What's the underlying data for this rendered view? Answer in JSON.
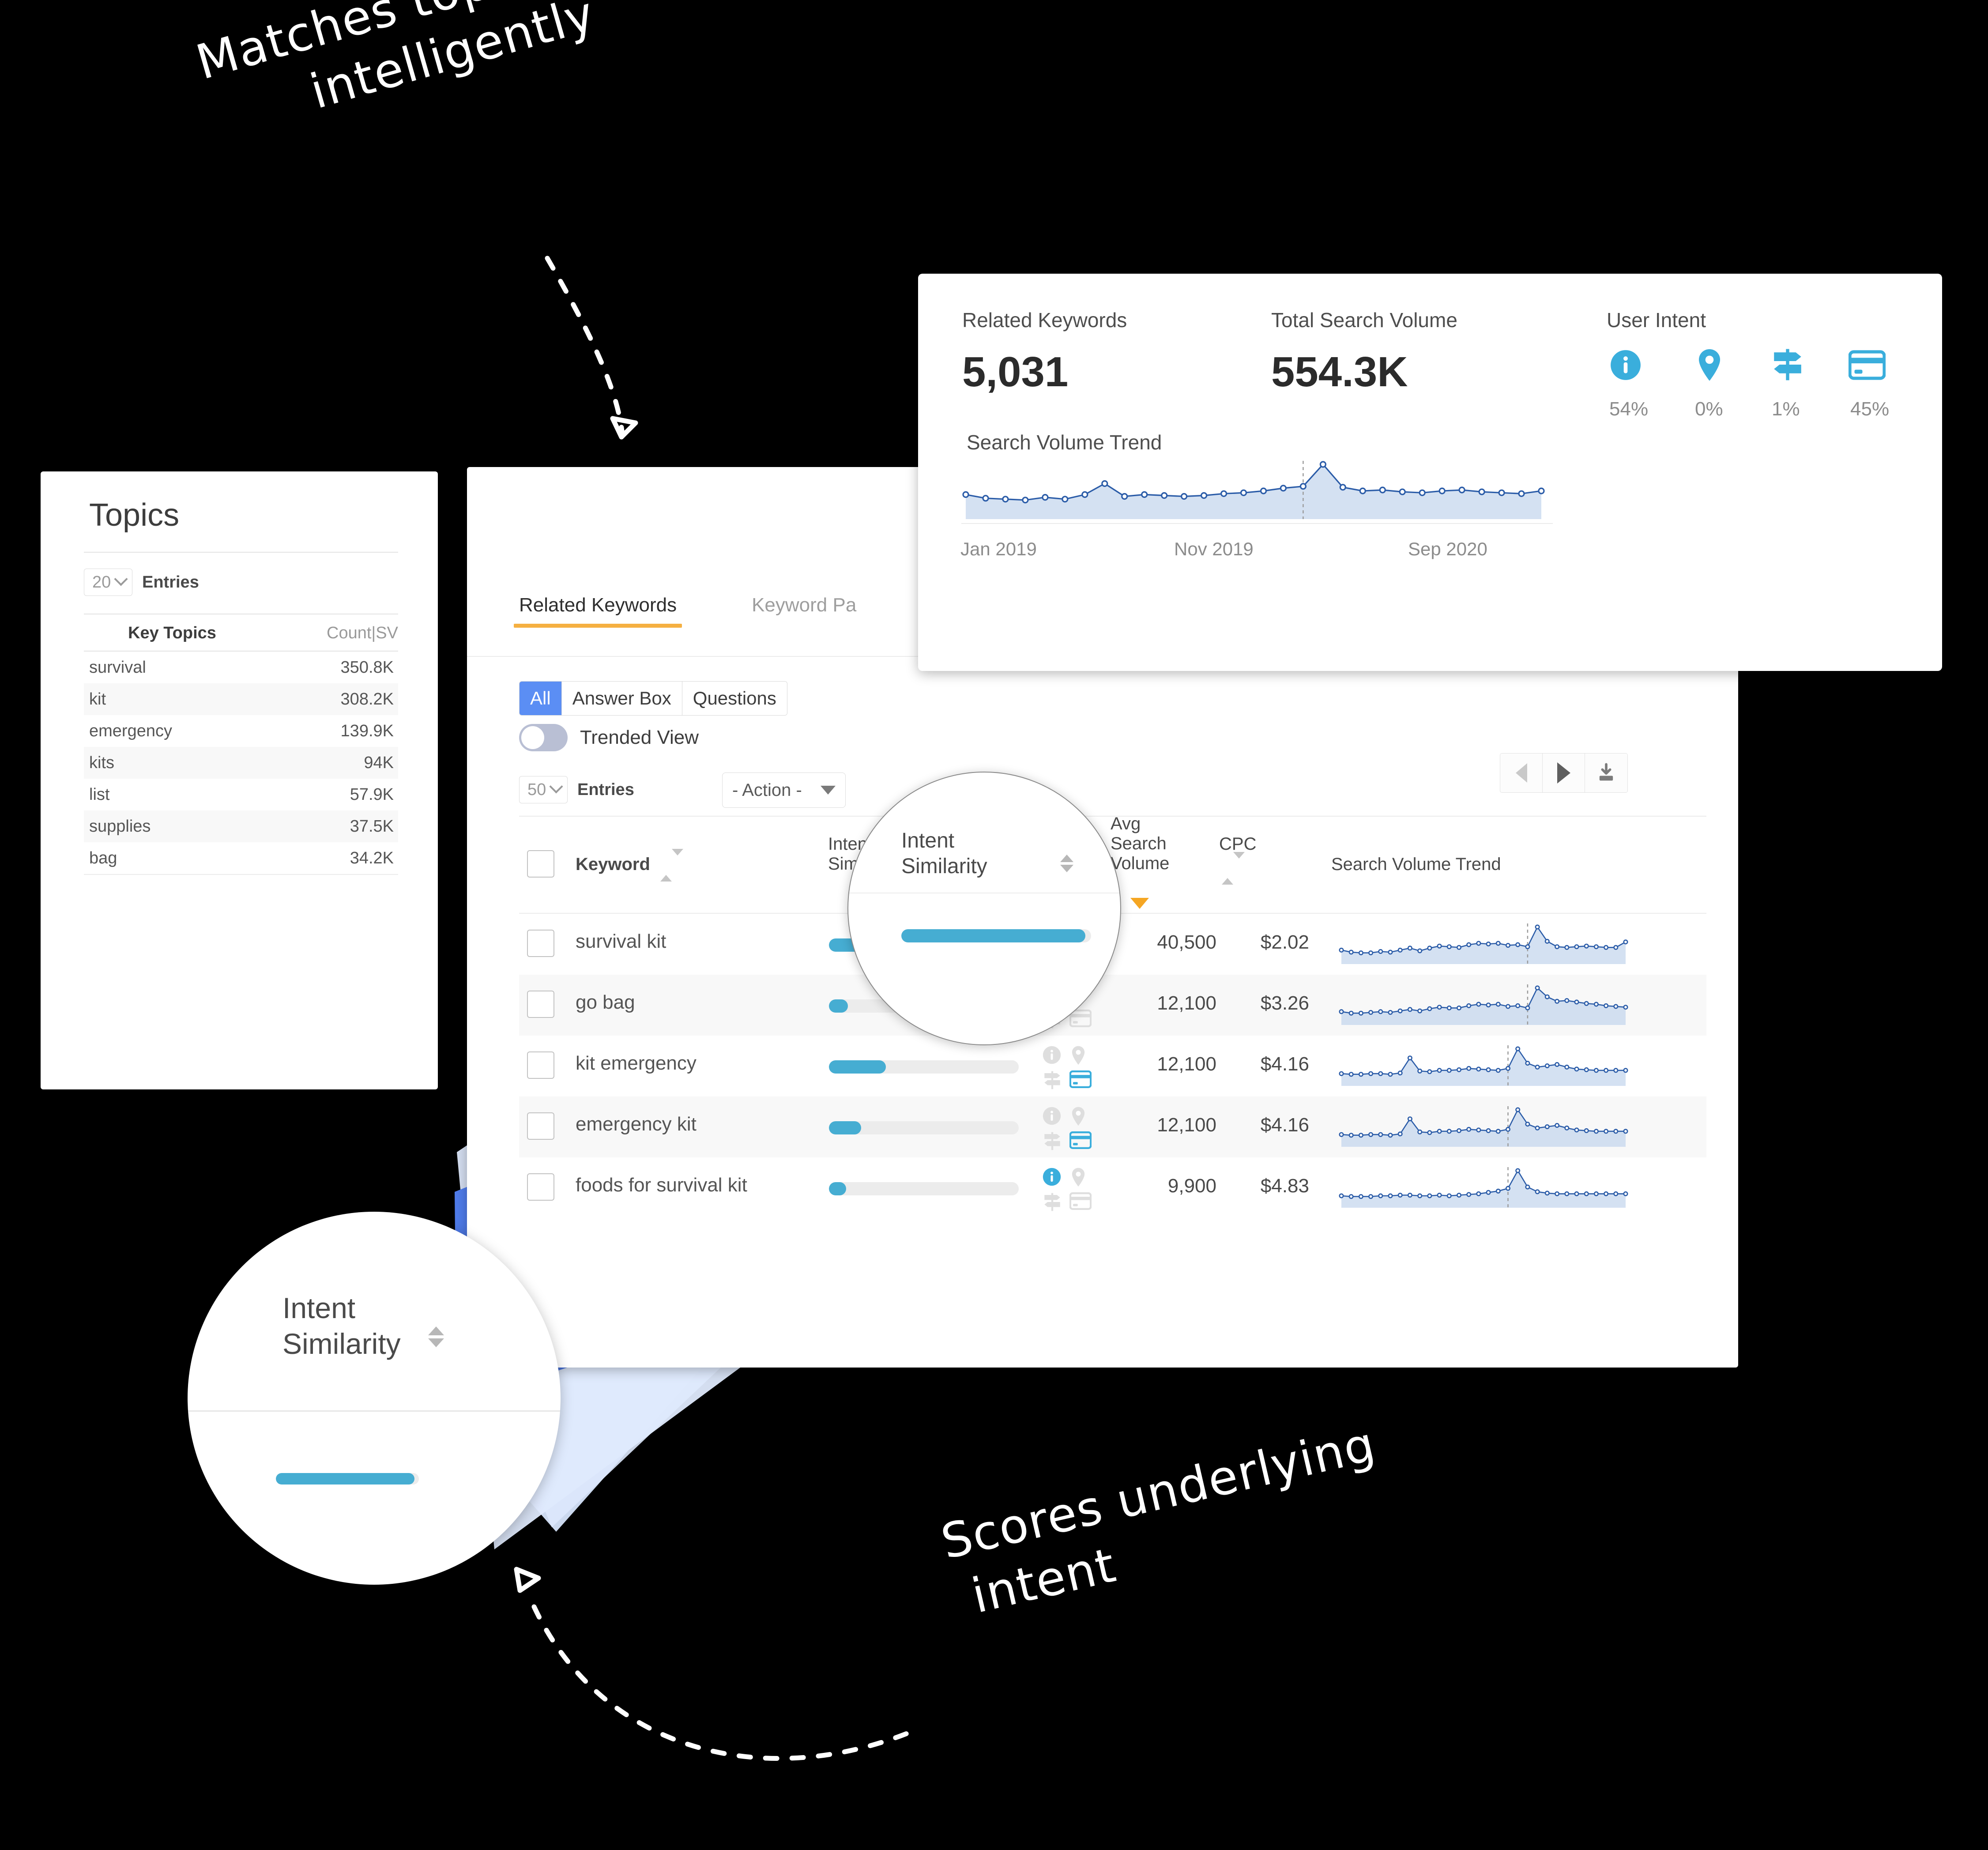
{
  "annotations": {
    "top": {
      "line1": "Matches topics",
      "line2": "intelligently"
    },
    "bottom": {
      "line1": "Scores underlying",
      "line2": "intent"
    }
  },
  "topics_panel": {
    "title": "Topics",
    "entries_value": "20",
    "entries_label": "Entries",
    "columns": {
      "key_topics": "Key Topics",
      "count_sv": "Count|SV"
    },
    "rows": [
      {
        "topic": "survival",
        "value": "350.8K"
      },
      {
        "topic": "kit",
        "value": "308.2K"
      },
      {
        "topic": "emergency",
        "value": "139.9K"
      },
      {
        "topic": "kits",
        "value": "94K"
      },
      {
        "topic": "list",
        "value": "57.9K"
      },
      {
        "topic": "supplies",
        "value": "37.5K"
      },
      {
        "topic": "bag",
        "value": "34.2K"
      }
    ]
  },
  "main_panel": {
    "tabs": [
      {
        "label": "Related Keywords",
        "active": true
      },
      {
        "label": "Keyword Pa",
        "active": false
      }
    ],
    "segmented": [
      {
        "label": "All",
        "active": true
      },
      {
        "label": "Answer Box",
        "active": false
      },
      {
        "label": "Questions",
        "active": false
      }
    ],
    "trended_view_label": "Trended View",
    "trended_view_on": false,
    "entries_value": "50",
    "entries_label": "Entries",
    "action_label": "- Action -",
    "pager": {
      "prev_icon": "chevron-left-icon",
      "next_icon": "chevron-right-icon",
      "download_icon": "download-icon"
    },
    "table": {
      "columns": {
        "keyword": "Keyword",
        "intent_similarity": "Intent\nSimilarity",
        "user_intent": "User\nIntent",
        "avg_search_volume": "Avg\nSearch\nVolume",
        "cpc": "CPC",
        "search_volume_trend": "Search Volume Trend"
      },
      "sorted_by": "avg_search_volume",
      "sort_direction": "desc",
      "rows": [
        {
          "keyword": "survival kit",
          "intent_similarity_pct": 97,
          "intents": [
            "informational"
          ],
          "avg_search_volume": "40,500",
          "cpc": "$2.02"
        },
        {
          "keyword": "go bag",
          "intent_similarity_pct": 10,
          "intents": [
            "informational"
          ],
          "avg_search_volume": "12,100",
          "cpc": "$3.26"
        },
        {
          "keyword": "kit emergency",
          "intent_similarity_pct": 30,
          "intents": [
            "transactional"
          ],
          "avg_search_volume": "12,100",
          "cpc": "$4.16"
        },
        {
          "keyword": "emergency kit",
          "intent_similarity_pct": 17,
          "intents": [
            "transactional"
          ],
          "avg_search_volume": "12,100",
          "cpc": "$4.16"
        },
        {
          "keyword": "foods for survival kit",
          "intent_similarity_pct": 9,
          "intents": [
            "informational"
          ],
          "avg_search_volume": "9,900",
          "cpc": "$4.83"
        }
      ]
    }
  },
  "stats_panel": {
    "related_keywords_label": "Related Keywords",
    "related_keywords_value": "5,031",
    "total_search_volume_label": "Total Search Volume",
    "total_search_volume_value": "554.3K",
    "user_intent_label": "User Intent",
    "user_intent": [
      {
        "icon": "info-icon",
        "pct": "54%"
      },
      {
        "icon": "map-pin-icon",
        "pct": "0%"
      },
      {
        "icon": "signpost-icon",
        "pct": "1%"
      },
      {
        "icon": "credit-card-icon",
        "pct": "45%"
      }
    ],
    "search_volume_trend_label": "Search Volume Trend",
    "axis_ticks": [
      "Jan 2019",
      "Nov 2019",
      "Sep 2020"
    ]
  },
  "magnifiers": {
    "top": {
      "title": "Intent\nSimilarity",
      "bar_pct": 97
    },
    "bottom": {
      "title": "Intent\nSimilarity",
      "bar_pct": 97
    }
  },
  "colors": {
    "accent_blue": "#46ADD2",
    "segment_active": "#5b8ef4",
    "tab_underline": "#f5b041",
    "sort_orange": "#f5a623",
    "spark_line": "#2b5ca8",
    "spark_fill": "#c5d7ed"
  },
  "chart_data": [
    {
      "type": "area",
      "title": "Search Volume Trend",
      "xlabel": "",
      "ylabel": "",
      "tick_labels": [
        "Jan 2019",
        "Nov 2019",
        "Sep 2020"
      ],
      "values": [
        22,
        18,
        17,
        16,
        19,
        17,
        22,
        34,
        20,
        22,
        21,
        20,
        21,
        23,
        24,
        26,
        29,
        31,
        55,
        30,
        26,
        27,
        25,
        24,
        26,
        27,
        25,
        24,
        23,
        26
      ],
      "marker_line_color": "#2b5ca8",
      "fill_color": "#c5d7ed",
      "reference_line_index": 17,
      "grid": false
    },
    {
      "type": "line",
      "title": "survival kit sparkline",
      "values": [
        14,
        11,
        10,
        10,
        12,
        11,
        14,
        17,
        13,
        17,
        20,
        19,
        18,
        22,
        24,
        23,
        24,
        21,
        22,
        19,
        48,
        27,
        19,
        18,
        19,
        20,
        19,
        18,
        18,
        26
      ],
      "reference_line_index": 19
    },
    {
      "type": "line",
      "title": "go bag sparkline",
      "values": [
        12,
        10,
        10,
        11,
        12,
        11,
        13,
        15,
        13,
        16,
        18,
        17,
        17,
        20,
        22,
        21,
        22,
        19,
        20,
        17,
        44,
        32,
        26,
        27,
        25,
        23,
        22,
        20,
        19,
        18
      ],
      "reference_line_index": 19
    },
    {
      "type": "line",
      "title": "kit emergency sparkline",
      "values": [
        12,
        11,
        11,
        12,
        12,
        11,
        13,
        36,
        16,
        15,
        17,
        17,
        18,
        20,
        19,
        18,
        17,
        20,
        50,
        28,
        22,
        24,
        26,
        22,
        19,
        18,
        17,
        17,
        17,
        17
      ],
      "reference_line_index": 17
    },
    {
      "type": "line",
      "title": "emergency kit sparkline",
      "values": [
        12,
        11,
        11,
        12,
        12,
        11,
        13,
        36,
        16,
        15,
        17,
        17,
        18,
        20,
        19,
        18,
        17,
        20,
        50,
        28,
        22,
        24,
        26,
        22,
        19,
        18,
        17,
        17,
        17,
        17
      ],
      "reference_line_index": 17
    },
    {
      "type": "line",
      "title": "foods for survival kit sparkline",
      "values": [
        11,
        10,
        10,
        10,
        11,
        11,
        12,
        12,
        11,
        11,
        12,
        11,
        12,
        13,
        14,
        16,
        18,
        22,
        48,
        24,
        17,
        15,
        14,
        14,
        14,
        14,
        14,
        14,
        14,
        14
      ],
      "reference_line_index": 17
    }
  ]
}
